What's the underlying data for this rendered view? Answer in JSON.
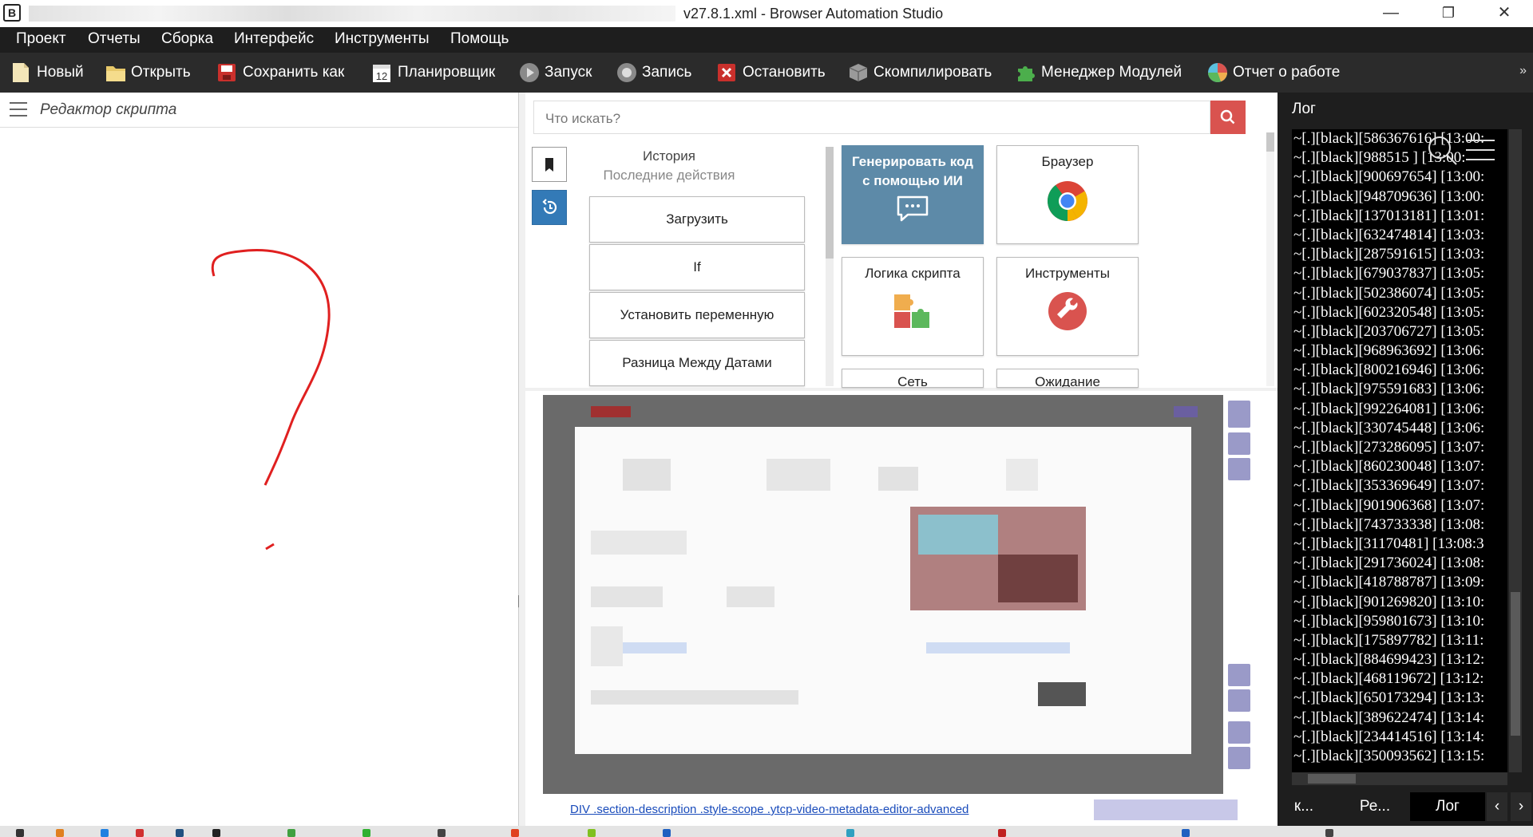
{
  "window": {
    "title": "v27.8.1.xml - Browser Automation Studio",
    "minimize": "—",
    "maximize": "❐",
    "close": "✕"
  },
  "menu": [
    "Проект",
    "Отчеты",
    "Сборка",
    "Интерфейс",
    "Инструменты",
    "Помощь"
  ],
  "toolbar": {
    "new": "Новый",
    "open": "Открыть",
    "save_as": "Сохранить как",
    "scheduler": "Планировщик",
    "scheduler_icon_number": "12",
    "run": "Запуск",
    "record": "Запись",
    "stop": "Остановить",
    "compile": "Скомпилировать",
    "module_manager": "Менеджер Модулей",
    "report": "Отчет о работе",
    "more": "»"
  },
  "editor": {
    "title": "Редактор скрипта"
  },
  "actions": {
    "search_placeholder": "Что искать?",
    "history_title": "История",
    "history_subtitle": "Последние действия",
    "history_items": [
      "Загрузить",
      "If",
      "Установить переменную",
      "Разница Между Датами"
    ],
    "tiles": {
      "ai": "Генерировать код с помощью ИИ",
      "browser": "Браузер",
      "logic": "Логика скрипта",
      "tools": "Инструменты",
      "network": "Сеть",
      "wait": "Ожидание"
    }
  },
  "browser": {
    "selector": "DIV .section-description .style-scope .ytcp-video-metadata-editor-advanced"
  },
  "log": {
    "title": "Лог",
    "lines": [
      "~[.][black][586367616] [13:00:",
      "~[.][black][988515    ] [13:00:",
      "~[.][black][900697654] [13:00:",
      "~[.][black][948709636] [13:00:",
      "~[.][black][137013181] [13:01:",
      "~[.][black][632474814] [13:03:",
      "~[.][black][287591615] [13:03:",
      "~[.][black][679037837] [13:05:",
      "~[.][black][502386074] [13:05:",
      "~[.][black][602320548] [13:05:",
      "~[.][black][203706727] [13:05:",
      "~[.][black][968963692] [13:06:",
      "~[.][black][800216946] [13:06:",
      "~[.][black][975591683] [13:06:",
      "~[.][black][992264081] [13:06:",
      "~[.][black][330745448] [13:06:",
      "~[.][black][273286095] [13:07:",
      "~[.][black][860230048] [13:07:",
      "~[.][black][353369649] [13:07:",
      "~[.][black][901906368] [13:07:",
      "~[.][black][743733338] [13:08:",
      "~[.][black][31170481] [13:08:3",
      "~[.][black][291736024] [13:08:",
      "~[.][black][418788787] [13:09:",
      "~[.][black][901269820] [13:10:",
      "~[.][black][959801673] [13:10:",
      "~[.][black][175897782] [13:11:",
      "~[.][black][884699423] [13:12:",
      "~[.][black][468119672] [13:12:",
      "~[.][black][650173294] [13:13:",
      "~[.][black][389622474] [13:14:",
      "~[.][black][234414516] [13:14:",
      "~[.][black][350093562] [13:15:"
    ],
    "tabs": [
      "к...",
      "Ре...",
      "Лог"
    ]
  },
  "colors": {
    "menubar": "#1e1e1e",
    "toolbar": "#2b2b2b",
    "accent_blue": "#337ab7",
    "search_button": "#d9534f",
    "ai_tile": "#5d8aa8",
    "question_mark": "#e02020"
  }
}
